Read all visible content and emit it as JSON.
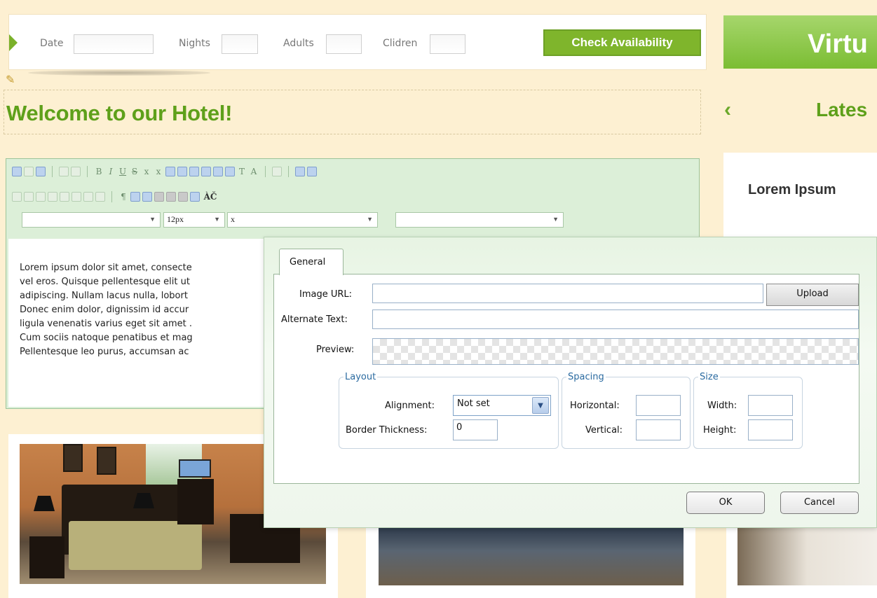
{
  "booking": {
    "date_label": "Date",
    "nights_label": "Nights",
    "adults_label": "Adults",
    "children_label": "Clidren",
    "check_button": "Check Availability",
    "date_value": "",
    "nights_value": "",
    "adults_value": "",
    "children_value": ""
  },
  "banner": {
    "text": "Virtu"
  },
  "page": {
    "welcome_title": "Welcome to our Hotel!",
    "latest_title": "Lates",
    "lorem_heading": "Lorem Ipsum"
  },
  "editor": {
    "font_size": "12px",
    "format_value": "x",
    "font_name_value": "",
    "style_value": "",
    "toolbar_text_glyph": "ÀČ",
    "body_text": "Lorem ipsum dolor sit amet, consecte\nvel eros. Quisque pellentesque elit ut\nadipiscing. Nullam lacus nulla, lobort\nDonec enim dolor, dignissim id accur\nligula venenatis varius eget sit amet .\nCum sociis natoque penatibus et mag\nPellentesque leo purus, accumsan ac"
  },
  "dialog": {
    "tab_label": "General",
    "image_url_label": "Image URL:",
    "image_url_value": "",
    "upload_label": "Upload",
    "alt_text_label": "Alternate Text:",
    "alt_text_value": "",
    "preview_label": "Preview:",
    "layout_legend": "Layout",
    "alignment_label": "Alignment:",
    "alignment_value": "Not set",
    "border_label": "Border Thickness:",
    "border_value": "0",
    "spacing_legend": "Spacing",
    "horizontal_label": "Horizontal:",
    "horizontal_value": "",
    "vertical_label": "Vertical:",
    "vertical_value": "",
    "size_legend": "Size",
    "width_label": "Width:",
    "width_value": "",
    "height_label": "Height:",
    "height_value": "",
    "ok_label": "OK",
    "cancel_label": "Cancel"
  },
  "colors": {
    "accent_green": "#7fb52c",
    "heading_green": "#5ea01a",
    "page_background": "#fdf0d2"
  }
}
